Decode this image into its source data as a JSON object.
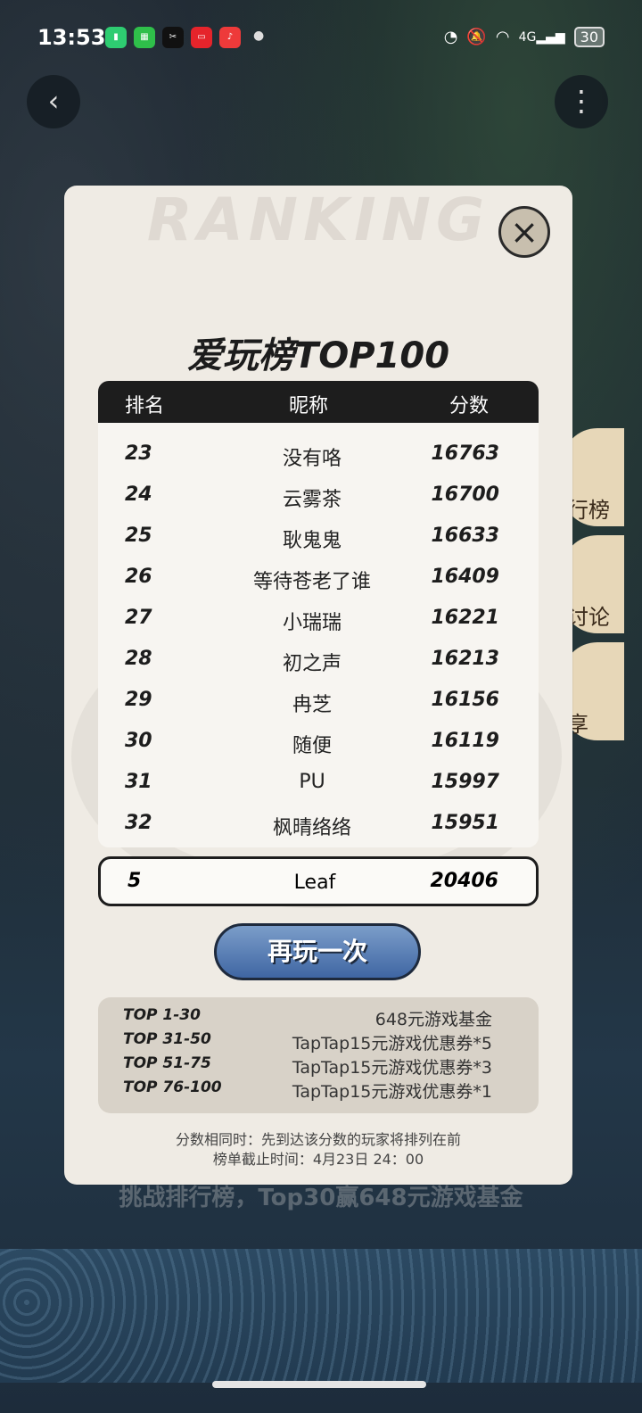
{
  "status_bar": {
    "time": "13:53",
    "network": "4G",
    "battery": "30"
  },
  "modal": {
    "watermark": "RANKING",
    "title": "爱玩榜TOP100",
    "close_icon": "×",
    "headers": {
      "rank": "排名",
      "nickname": "昵称",
      "score": "分数"
    },
    "rows": [
      {
        "rank": "23",
        "name": "没有咯",
        "score": "16763"
      },
      {
        "rank": "24",
        "name": "云雾茶",
        "score": "16700"
      },
      {
        "rank": "25",
        "name": "耿鬼鬼",
        "score": "16633"
      },
      {
        "rank": "26",
        "name": "等待苍老了谁",
        "score": "16409"
      },
      {
        "rank": "27",
        "name": "小瑞瑞",
        "score": "16221"
      },
      {
        "rank": "28",
        "name": "初之声",
        "score": "16213"
      },
      {
        "rank": "29",
        "name": "冉芝",
        "score": "16156"
      },
      {
        "rank": "30",
        "name": "随便",
        "score": "16119"
      },
      {
        "rank": "31",
        "name": "PU",
        "score": "15997"
      },
      {
        "rank": "32",
        "name": "枫晴络络",
        "score": "15951"
      }
    ],
    "my_row": {
      "rank": "5",
      "name": "Leaf",
      "score": "20406"
    },
    "play_again_label": "再玩一次",
    "rewards": [
      {
        "tier": "TOP 1-30",
        "prize": "648元游戏基金"
      },
      {
        "tier": "TOP 31-50",
        "prize": "TapTap15元游戏优惠券*5"
      },
      {
        "tier": "TOP 51-75",
        "prize": "TapTap15元游戏优惠券*3"
      },
      {
        "tier": "TOP 76-100",
        "prize": "TapTap15元游戏优惠券*1"
      }
    ],
    "note_tie": "分数相同时：先到达该分数的玩家将排列在前",
    "note_deadline": "榜单截止时间：4月23日 24：00"
  },
  "background": {
    "challenge_text": "挑战排行榜，Top30赢648元游戏基金",
    "side_items": [
      "行榜",
      "讨论",
      "享"
    ]
  },
  "colors": {
    "modal_bg": "#efebe4",
    "header_bg": "#1d1d1d",
    "button_blue": "#3f66a3"
  }
}
